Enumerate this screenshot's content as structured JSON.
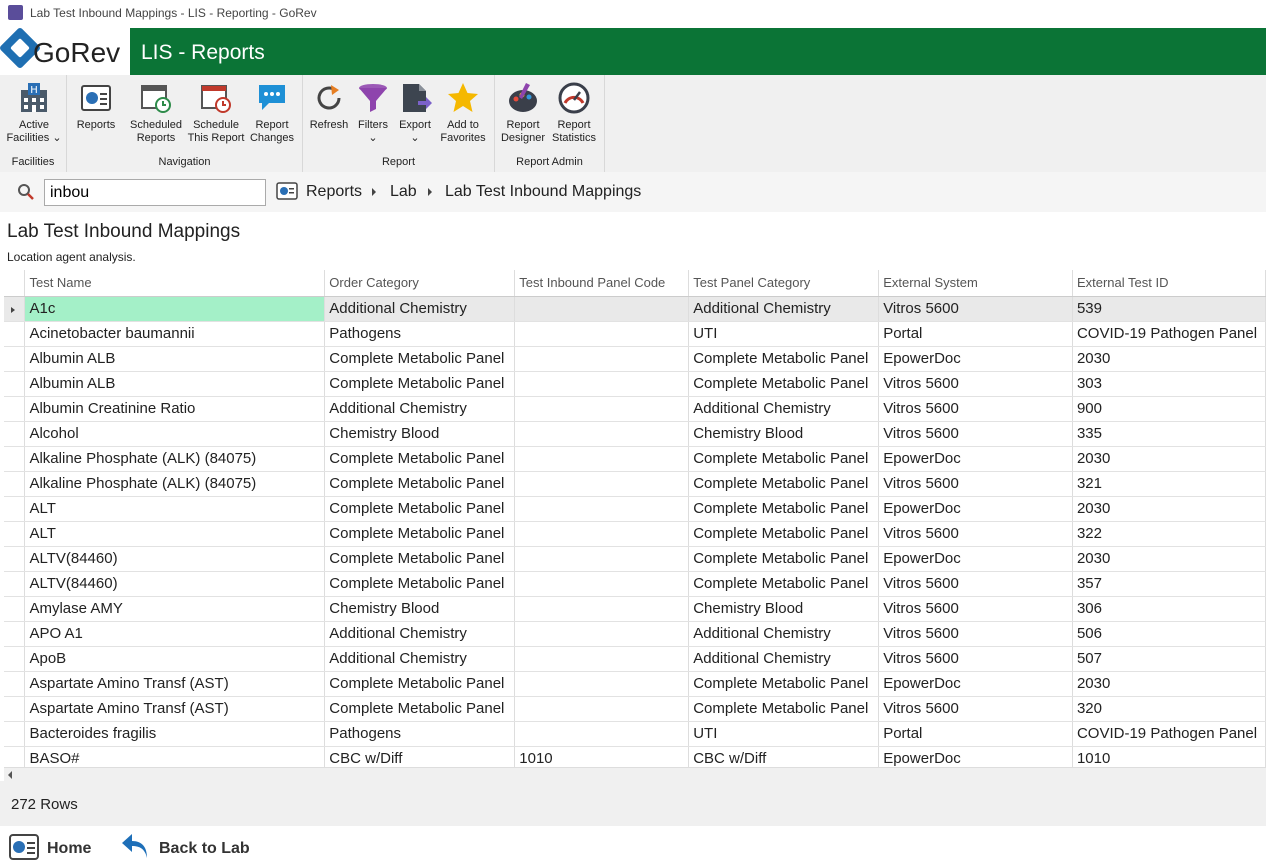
{
  "window": {
    "title": "Lab Test Inbound Mappings - LIS - Reporting - GoRev"
  },
  "brand": {
    "logo": "GoRev",
    "app_title": "LIS - Reports"
  },
  "ribbon": {
    "groups": {
      "facilities": "Facilities",
      "navigation": "Navigation",
      "report": "Report",
      "report_admin": "Report Admin"
    },
    "buttons": {
      "active_facilities": [
        "Active",
        "Facilities"
      ],
      "reports": [
        "Reports"
      ],
      "scheduled_reports": [
        "Scheduled",
        "Reports"
      ],
      "schedule_this_report": [
        "Schedule",
        "This Report"
      ],
      "report_changes": [
        "Report",
        "Changes"
      ],
      "refresh": [
        "Refresh"
      ],
      "filters": [
        "Filters"
      ],
      "export": [
        "Export"
      ],
      "add_to_favorites": [
        "Add to",
        "Favorites"
      ],
      "report_designer": [
        "Report",
        "Designer"
      ],
      "report_statistics": [
        "Report",
        "Statistics"
      ]
    }
  },
  "search": {
    "value": "inbou"
  },
  "breadcrumb": [
    "Reports",
    "Lab",
    "Lab Test Inbound Mappings"
  ],
  "page": {
    "title": "Lab Test Inbound Mappings",
    "description": "Location agent analysis."
  },
  "grid": {
    "columns": [
      "Test Name",
      "Order Category",
      "Test Inbound Panel Code",
      "Test Panel Category",
      "External System",
      "External Test ID"
    ],
    "rows": [
      [
        "A1c",
        "Additional Chemistry",
        "",
        "Additional Chemistry",
        "Vitros 5600",
        "539"
      ],
      [
        "Acinetobacter baumannii",
        "Pathogens",
        "",
        "UTI",
        "Portal",
        "COVID-19 Pathogen Panel"
      ],
      [
        "Albumin ALB",
        "Complete Metabolic Panel",
        "",
        "Complete Metabolic Panel",
        "EpowerDoc",
        "2030"
      ],
      [
        "Albumin ALB",
        "Complete Metabolic Panel",
        "",
        "Complete Metabolic Panel",
        "Vitros 5600",
        "303"
      ],
      [
        "Albumin Creatinine Ratio",
        "Additional Chemistry",
        "",
        "Additional Chemistry",
        "Vitros 5600",
        "900"
      ],
      [
        "Alcohol",
        "Chemistry Blood",
        "",
        "Chemistry Blood",
        "Vitros 5600",
        "335"
      ],
      [
        "Alkaline Phosphate (ALK) (84075)",
        "Complete Metabolic Panel",
        "",
        "Complete Metabolic Panel",
        "EpowerDoc",
        "2030"
      ],
      [
        "Alkaline Phosphate (ALK) (84075)",
        "Complete Metabolic Panel",
        "",
        "Complete Metabolic Panel",
        "Vitros 5600",
        "321"
      ],
      [
        "ALT",
        "Complete Metabolic Panel",
        "",
        "Complete Metabolic Panel",
        "EpowerDoc",
        "2030"
      ],
      [
        "ALT",
        "Complete Metabolic Panel",
        "",
        "Complete Metabolic Panel",
        "Vitros 5600",
        "322"
      ],
      [
        "ALTV(84460)",
        "Complete Metabolic Panel",
        "",
        "Complete Metabolic Panel",
        "EpowerDoc",
        "2030"
      ],
      [
        "ALTV(84460)",
        "Complete Metabolic Panel",
        "",
        "Complete Metabolic Panel",
        "Vitros 5600",
        "357"
      ],
      [
        "Amylase AMY",
        "Chemistry Blood",
        "",
        "Chemistry Blood",
        "Vitros 5600",
        "306"
      ],
      [
        "APO A1",
        "Additional Chemistry",
        "",
        "Additional Chemistry",
        "Vitros 5600",
        "506"
      ],
      [
        "ApoB",
        "Additional Chemistry",
        "",
        "Additional Chemistry",
        "Vitros 5600",
        "507"
      ],
      [
        "Aspartate Amino Transf (AST)",
        "Complete Metabolic Panel",
        "",
        "Complete Metabolic Panel",
        "EpowerDoc",
        "2030"
      ],
      [
        "Aspartate Amino Transf (AST)",
        "Complete Metabolic Panel",
        "",
        "Complete Metabolic Panel",
        "Vitros 5600",
        "320"
      ],
      [
        "Bacteroides fragilis",
        "Pathogens",
        "",
        "UTI",
        "Portal",
        "COVID-19 Pathogen Panel"
      ],
      [
        "BASO#",
        "CBC w/Diff",
        "1010",
        "CBC w/Diff",
        "EpowerDoc",
        "1010"
      ]
    ]
  },
  "status": {
    "row_count": "272 Rows"
  },
  "footer": {
    "home": "Home",
    "back": "Back to Lab"
  },
  "colors": {
    "brand_green": "#0b7436",
    "selected_cell": "#a4f0c8",
    "logo_blue": "#1f6fb2"
  }
}
